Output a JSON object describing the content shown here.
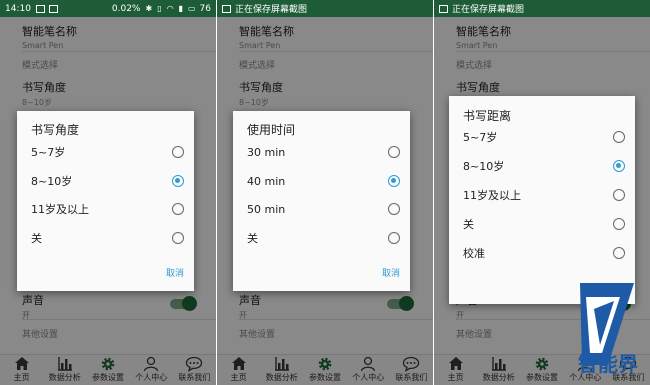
{
  "colors": {
    "status_bar": "#1e5c37",
    "accent": "#2f9bd1",
    "toggle": "#1e6b3a"
  },
  "status_left": {
    "time": "14:10",
    "net": "0.02",
    "unit": "%",
    "battery": "76"
  },
  "status_saving": "正在保存屏幕截图",
  "settings": {
    "pen_name_title": "智能笔名称",
    "pen_name_value": "Smart Pen",
    "mode_section": "模式选择",
    "writing_angle_title": "书写角度",
    "writing_angle_value": "8~10岁",
    "sound_title": "声音",
    "sound_value": "开",
    "other_section": "其他设置"
  },
  "nav": [
    {
      "label": "主页",
      "icon": "home-icon"
    },
    {
      "label": "数据分析",
      "icon": "bar-chart-icon"
    },
    {
      "label": "参数设置",
      "icon": "gear-icon"
    },
    {
      "label": "个人中心",
      "icon": "person-icon"
    },
    {
      "label": "联系我们",
      "icon": "chat-icon"
    }
  ],
  "dialogs": [
    {
      "title": "书写角度",
      "options": [
        "5~7岁",
        "8~10岁",
        "11岁及以上",
        "关"
      ],
      "selected": 1,
      "cancel": "取消"
    },
    {
      "title": "使用时间",
      "options": [
        "30 min",
        "40 min",
        "50 min",
        "关"
      ],
      "selected": 1,
      "cancel": "取消"
    },
    {
      "title": "书写距离",
      "options": [
        "5~7岁",
        "8~10岁",
        "11岁及以上",
        "关",
        "校准"
      ],
      "selected": 1,
      "cancel": "取消"
    }
  ],
  "watermark_text": "智能界"
}
